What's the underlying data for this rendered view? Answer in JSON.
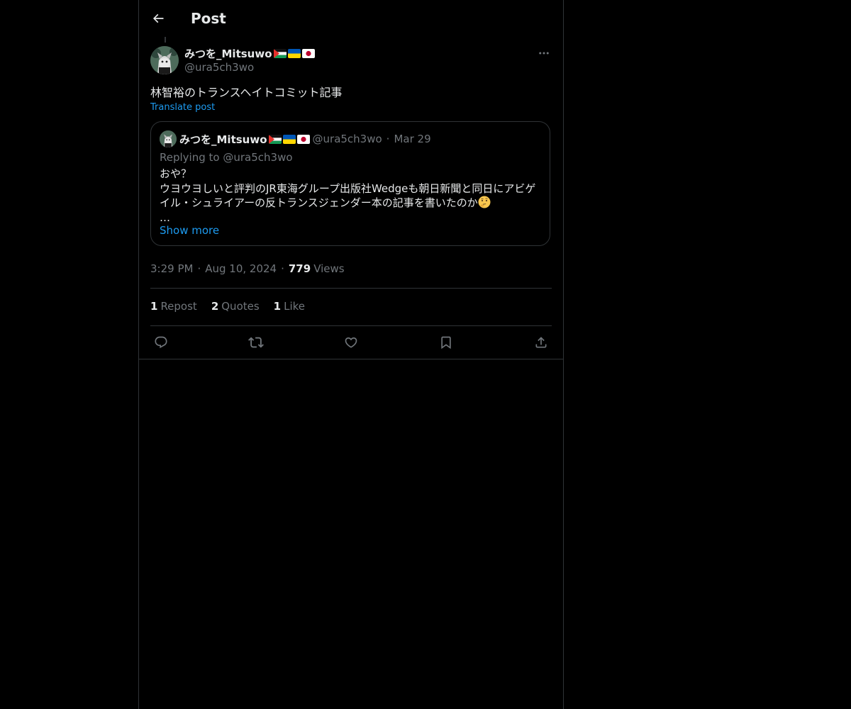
{
  "header": {
    "title": "Post"
  },
  "post": {
    "display_name": "みつを_Mitsuwo",
    "handle": "@ura5ch3wo",
    "text": "林智裕のトランスヘイトコミット記事",
    "translate_label": "Translate post",
    "flags": [
      "palestine-flag",
      "ukraine-flag",
      "japan-flag"
    ]
  },
  "quote": {
    "display_name": "みつを_Mitsuwo",
    "handle": "@ura5ch3wo",
    "separator": "·",
    "date": "Mar 29",
    "replying_prefix": "Replying to",
    "replying_to": "@ura5ch3wo",
    "body_line1": "おや？",
    "body_line2": "ウヨウヨしいと評判のJR東海グループ出版社Wedgeも朝日新聞と同日にアビゲイル・シュライアーの反トランスジェンダー本の記事を書いたのか",
    "emoji": "thinking-face-icon",
    "ellipsis": "…",
    "show_more": "Show more"
  },
  "meta": {
    "time": "3:29 PM",
    "separator": "·",
    "date": "Aug 10, 2024",
    "views_count": "779",
    "views_label": "Views"
  },
  "stats": {
    "reposts_count": "1",
    "reposts_label": "Repost",
    "quotes_count": "2",
    "quotes_label": "Quotes",
    "likes_count": "1",
    "likes_label": "Like"
  },
  "colors": {
    "background": "#000000",
    "text": "#e7e9ea",
    "secondary": "#71767b",
    "accent": "#1d9bf0",
    "border": "#2f3336"
  }
}
